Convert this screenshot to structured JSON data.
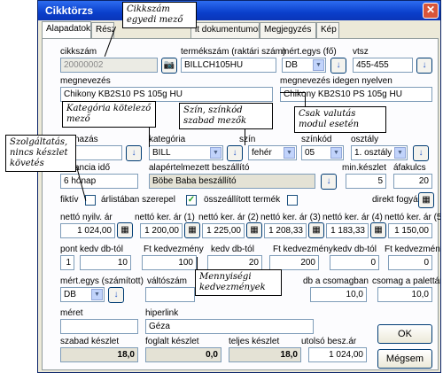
{
  "window": {
    "title": "Cikktörzs",
    "close": "✕"
  },
  "tabs": [
    "Alapadatok",
    "Részl",
    "lt dokumentumok",
    "Megjegyzés",
    "Kép"
  ],
  "labels": {
    "cikkszam": "cikkszám",
    "termekszam": "termékszám (raktári szám)",
    "mertegys_fo": "mért.egys (fő)",
    "vtsz": "vtsz",
    "megnevezes": "megnevezés",
    "megnevezes_idegen": "megnevezés idegen nyelven",
    "csoport": "nazás",
    "kategoria": "kategória",
    "szin": "szín",
    "szinkod": "színkód",
    "osztaly": "osztály",
    "garancia": "ancia idő",
    "alap_beszallito": "alapértelmezett beszállító",
    "min_keszlet": "min.készlet",
    "afakulcs": "áfakulcs",
    "fiktiv": "fiktív",
    "arlistaban": "árlistában szerepel",
    "osszeallitott": "összeállított termék",
    "direkt_fogyas": "direkt fogyás",
    "netto_nyilv": "nettó nyilv. ár",
    "netto_ker1": "nettó ker. ár (1)",
    "netto_ker2": "nettó ker. ár (2)",
    "netto_ker3": "nettó ker. ár (3)",
    "netto_ker4": "nettó ker. ár (4)",
    "netto_ker5": "nettó ker. ár (5)",
    "pont": "pont",
    "kedv_db_tol_1": "kedv db-tól",
    "ft_kedvezmeny_1": "Ft kedvezmény",
    "kedv_db_tol_2": "kedv db-tól",
    "ft_kedvezmeny_2": "Ft kedvezmény",
    "kedv_db_tol_3": "kedv db-tól",
    "ft_kedvezmeny_3": "Ft kedvezmény",
    "mertegys_szamitott": "mért.egys (számított)",
    "valtoszam": "váltószám",
    "db_a_csomagban": "db a csomagban",
    "csomag_a_palettan": "csomag a palettán",
    "meret": "méret",
    "hiperlink": "hiperlink",
    "szabad_keszlet": "szabad készlet",
    "foglalt_keszlet": "foglalt készlet",
    "teljes_keszlet": "teljes készlet",
    "utolso_besz_ar": "utolsó besz.ár"
  },
  "values": {
    "cikkszam": "20000002",
    "termekszam": "BILLCH105HU",
    "mertegys_fo": "DB",
    "vtsz": "455-455",
    "megnevezes": "Chikony KB2S10 PS 105g HU",
    "megnevezes_idegen": "Chikony KB2S10 PS 105g HU",
    "kategoria": "BILL",
    "szin": "fehér",
    "szinkod": "05",
    "osztaly": "1. osztály",
    "garancia": "6 hónap",
    "alap_beszallito": "Böbe Baba beszállító",
    "min_keszlet": "5",
    "afakulcs": "20",
    "netto_nyilv": "1 024,00",
    "netto_ker1": "1 200,00",
    "netto_ker2": "1 225,00",
    "netto_ker3": "1 208,33",
    "netto_ker4": "1 183,33",
    "netto_ker5": "1 150,00",
    "pont": "1",
    "kedv_db_tol_1": "10",
    "ft_kedvezmeny_1": "100",
    "kedv_db_tol_2": "20",
    "ft_kedvezmeny_2": "200",
    "kedv_db_tol_3": "0",
    "ft_kedvezmeny_3": "0",
    "mertegys_szamitott": "DB",
    "valtoszam": "",
    "db_a_csomagban": "10,0",
    "csomag_a_palettan": "10,0",
    "meret": "",
    "hiperlink": "Géza",
    "szabad_keszlet": "18,0",
    "foglalt_keszlet": "0,0",
    "teljes_keszlet": "18,0",
    "utolso_besz_ar": "1 024,00"
  },
  "buttons": {
    "ok": "OK",
    "megsem": "Mégsem"
  },
  "callouts": {
    "cikkszam": "Cikkszám egyedi mező",
    "kategoria": "Kategória kötelező mező",
    "szin": "Szín, színkód szabad mezők",
    "valuta": "Csak valutás modul esetén",
    "szolgaltatas": "Szolgáltatás, nincs készlet követés",
    "mennyisegi": "Mennyiségi kedvezmények"
  },
  "glyphs": {
    "down": "▼",
    "arrow_down": "↓",
    "camera": "📷",
    "calc": "▦",
    "check": "✓"
  }
}
